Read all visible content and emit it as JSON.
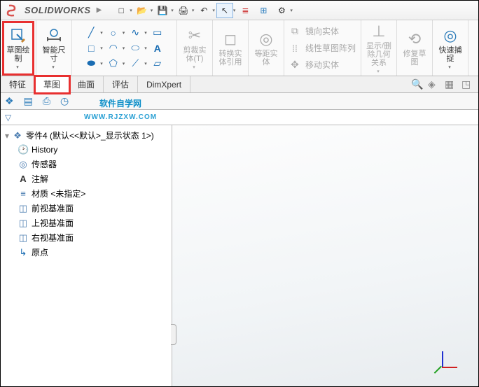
{
  "app": {
    "logo_text": "SOLIDWORKS"
  },
  "qat": {
    "new": "□",
    "open": "📂",
    "save": "💾",
    "print": "🖨",
    "undo": "↶",
    "select": "↖",
    "options1": "≣",
    "options2": "⊞",
    "settings": "⚙"
  },
  "ribbon": {
    "sketch_create": "草图绘\n制",
    "smart_dim": "智能尺\n寸",
    "trim": "剪裁实\n体(T)",
    "convert": "转换实\n体引用",
    "offset": "等距实\n体",
    "mirror": "镜向实体",
    "linear_pattern": "线性草图阵列",
    "move": "移动实体",
    "display_delete": "显示/删\n除几何\n关系",
    "repair": "修复草\n图",
    "quick_snap": "快速捕\n捉"
  },
  "tabs": {
    "features": "特征",
    "sketch": "草图",
    "surfaces": "曲面",
    "evaluate": "评估",
    "dimxpert": "DimXpert"
  },
  "watermark": {
    "main": "软件自学网",
    "sub": "WWW.RJZXW.COM"
  },
  "tree": {
    "root": "零件4  (默认<<默认>_显示状态 1>)",
    "history": "History",
    "sensors": "传感器",
    "annotations": "注解",
    "material": "材质 <未指定>",
    "front": "前视基准面",
    "top": "上视基准面",
    "right": "右视基准面",
    "origin": "原点"
  }
}
